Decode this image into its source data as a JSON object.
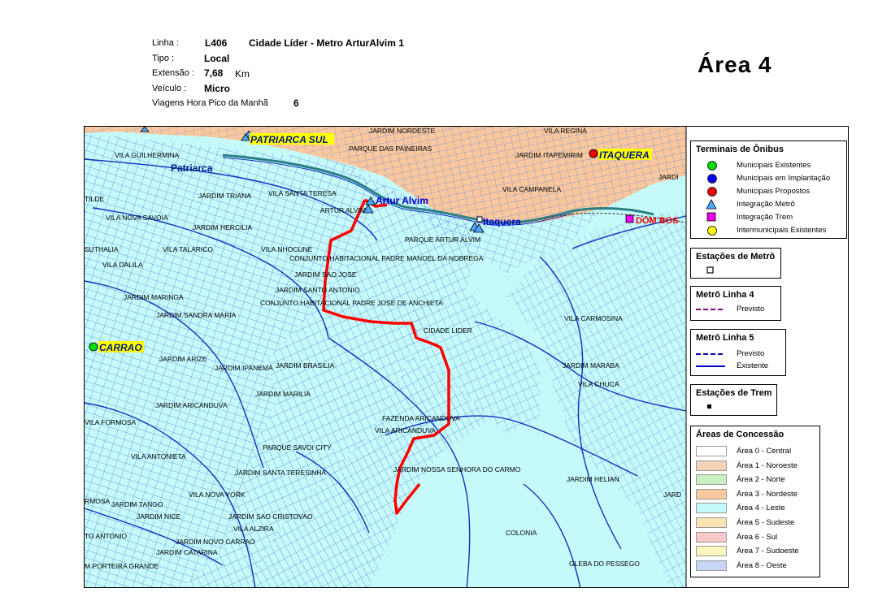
{
  "header": {
    "linha_label": "Linha :",
    "linha_code": "L406",
    "linha_name": "Cidade Líder - Metro ArturAlvim 1",
    "tipo_label": "Tipo :",
    "tipo_value": "Local",
    "extensao_label": "Extensão :",
    "extensao_value": "7,68",
    "extensao_unit": "Km",
    "veiculo_label": "Veículo :",
    "veiculo_value": "Micro",
    "viagens_label": "Viagens Hora Pico da Manhã",
    "viagens_value": "6",
    "area_title": "Área  4"
  },
  "map": {
    "place_labels": [
      "JARDIM NORDESTE",
      "VILA REGINA",
      "PARQUE DAS PAINEIRAS",
      "VILA GUILHERMINA",
      "JARDIM ITAPEMIRIM",
      "JARDIM TRIANA",
      "VILA SANTA TERESA",
      "VILA CAMPANELA",
      "TILDE",
      "ARTUR ALVIM",
      "VILA NOVA SAVOIA",
      "JARDIM HERCILIA",
      "PARQUE ARTUR ALVIM",
      "SUTHALIA",
      "VILA TALARICO",
      "VILA NHOCUNE",
      "VILA DALILA",
      "CONJUNTO HABITACIONAL PADRE MANOEL DA NOBREGA",
      "JARDIM SAO JOSE",
      "JARDIM SANTO ANTONIO",
      "JARDIM MARINGA",
      "CONJUNTO HABITACIONAL PADRE JOSE DE ANCHIETA",
      "JARDIM SANDRA MARIA",
      "VILA CARMOSINA",
      "CIDADE LIDER",
      "JARDIM ARIZE",
      "JARDIM BRASILIA",
      "JARDIM IPANEMA",
      "JARDIM MARABA",
      "VILA CHUCA",
      "JARDIM MARILIA",
      "JARDIM ARICANDUVA",
      "VILA FORMOSA",
      "FAZENDA ARICANDUVA",
      "VILA ARICANDUVA",
      "PARQUE SAVOI CITY",
      "VILA ANTONIETA",
      "JARDIM SANTA TERESINHA",
      "JARDIM NOSSA SENHORA DO CARMO",
      "JARDIM HELIAN",
      "VILA NOVA YORK",
      "JARDIM TANGO",
      "RMOSA",
      "JARDIM NICE",
      "JARDIM SAO CRISTOVAO",
      "JARD",
      "TO ANTONIO",
      "VILA ALZIRA",
      "JARDIM NOVO CARRAO",
      "JARDIM CATARINA",
      "COLONIA",
      "M PORTEIRA GRANDE",
      "GLEBA DO PESSEGO",
      "JARDI",
      "JARDI"
    ],
    "district_labels": [
      "Patriarca"
    ],
    "terminals": {
      "patriarca_sul": "PATRIARCA SUL",
      "itaquera": "ITAQUERA",
      "carrao": "CARRAO",
      "dom_bosco": "DOM BOS"
    },
    "metro_stations": {
      "artur_alvim": "Artur Alvim",
      "itaquera": "Itaquera"
    },
    "colors": {
      "area4": "#c6fafa",
      "area3": "#f9c89e",
      "route": "#ff0000",
      "metro_line": "#2a7f86",
      "streets_dense": "#4f7ed6",
      "streets_major": "#1030c0"
    }
  },
  "legend": {
    "terminais": {
      "title": "Terminais de Ônibus",
      "items": [
        {
          "label": "Municipais Existentes",
          "color": "#00dd00",
          "icon": "circle-icon"
        },
        {
          "label": "Municipais em Implantação",
          "color": "#0000ee",
          "icon": "circle-icon"
        },
        {
          "label": "Municipais Propostos",
          "color": "#ee0000",
          "icon": "circle-icon"
        },
        {
          "label": "Integração Metrô",
          "color": "#4aa8ff",
          "icon": "triangle-icon"
        },
        {
          "label": "Integração Trem",
          "color": "#ee00ee",
          "icon": "square-icon"
        },
        {
          "label": "Intermunicipais Existentes",
          "color": "#ffff00",
          "icon": "circle-icon"
        }
      ]
    },
    "estacoes_metro": {
      "title": "Estações de Metrô"
    },
    "metro_l4": {
      "title": "Metrô Linha 4",
      "items": [
        {
          "label": "Previsto",
          "color": "#800080",
          "style": "dashed"
        }
      ]
    },
    "metro_l5": {
      "title": "Metrô Linha 5",
      "items": [
        {
          "label": "Previsto",
          "color": "#0000cc",
          "style": "dashed"
        },
        {
          "label": "Existente",
          "color": "#0000cc",
          "style": "solid"
        }
      ]
    },
    "estacoes_trem": {
      "title": "Estações de Trem"
    },
    "areas": {
      "title": "Áreas de Concessão",
      "items": [
        {
          "label": "Área 0 - Central",
          "color": "#ffffff"
        },
        {
          "label": "Área 1 - Noroeste",
          "color": "#f6d2b6"
        },
        {
          "label": "Área 2 - Norte",
          "color": "#c8f0c0"
        },
        {
          "label": "Área 3 - Nordeste",
          "color": "#f9c89e"
        },
        {
          "label": "Área 4 - Leste",
          "color": "#c6fafa"
        },
        {
          "label": "Área 5 - Sudeste",
          "color": "#fde3b4"
        },
        {
          "label": "Área 6 - Sul",
          "color": "#f8c8c8"
        },
        {
          "label": "Área 7 - Sudoeste",
          "color": "#fbf6c0"
        },
        {
          "label": "Área 8 - Oeste",
          "color": "#c6d6f4"
        }
      ]
    }
  }
}
